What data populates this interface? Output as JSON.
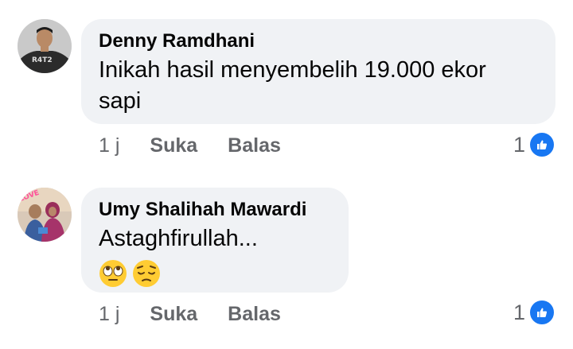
{
  "comments": [
    {
      "author": "Denny Ramdhani",
      "text_line1": "Inikah hasil menyembelih 19.000 ekor",
      "text_line2": "sapi",
      "time": "1 j",
      "like_label": "Suka",
      "reply_label": "Balas",
      "reaction_count": "1",
      "avatar_shirt_text": "R4T2"
    },
    {
      "author": "Umy Shalihah Mawardi",
      "text": "Astaghfirullah...",
      "emojis": [
        "face-with-rolling-eyes-emoji",
        "pensive-face-emoji"
      ],
      "time": "1 j",
      "like_label": "Suka",
      "reply_label": "Balas",
      "reaction_count": "1",
      "avatar_badge_text": "LOVE"
    }
  ],
  "colors": {
    "bubble": "#f0f2f5",
    "meta_text": "#65676b",
    "like_blue": "#1877f2"
  },
  "icons": [
    "thumbs-up-icon"
  ]
}
